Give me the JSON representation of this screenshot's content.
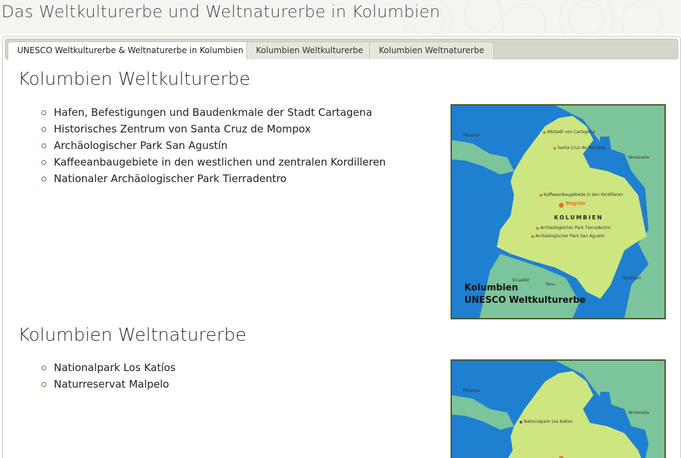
{
  "page": {
    "title": "Das Weltkulturerbe und Weltnaturerbe in Kolumbien"
  },
  "tabs": [
    {
      "label": "UNESCO Weltkulturerbe & Weltnaturerbe in Kolumbien",
      "active": true
    },
    {
      "label": "Kolumbien Weltkulturerbe",
      "active": false
    },
    {
      "label": "Kolumbien Weltnaturerbe",
      "active": false
    }
  ],
  "culture": {
    "heading": "Kolumbien Weltkulturerbe",
    "items": [
      "Hafen, Befestigungen und Baudenkmale der Stadt Cartagena",
      "Historisches Zentrum von Santa Cruz de Mompox",
      "Archäologischer Park San Agustín",
      "Kaffeeanbaugebiete in den westlichen und zentralen Kordilleren",
      "Nationaler Archäologischer Park Tierradentro"
    ],
    "map": {
      "caption_line1": "Kolumbien",
      "caption_line2": "UNESCO Weltkulturerbe",
      "country_label": "KOLUMBIEN",
      "capital": "Bogota",
      "neighbors": [
        "Venezuela",
        "Panama",
        "Ecuador",
        "Peru",
        "Brasilien"
      ],
      "sites": [
        "Altstadt von Cartagena",
        "Santa Cruz de Mompox",
        "Kaffeeanbaugebiete in den Kordilleren",
        "Archäologischer Park Tierradentro",
        "Archäologischer Park San Agustin"
      ]
    }
  },
  "nature": {
    "heading": "Kolumbien Weltnaturerbe",
    "items": [
      "Nationalpark Los Katíos",
      "Naturreservat Malpelo"
    ],
    "map": {
      "neighbors": [
        "Panama",
        "Venezuela"
      ],
      "sites": [
        "Nationalpark Los Katios"
      ]
    }
  },
  "colors": {
    "ocean": "#1f7fd1",
    "colombia": "#cde67f",
    "neighbors": "#7cc49b",
    "site_marker": "#e0742a",
    "map_border": "#4b5a2a",
    "bullet": "#4d7a3a"
  }
}
